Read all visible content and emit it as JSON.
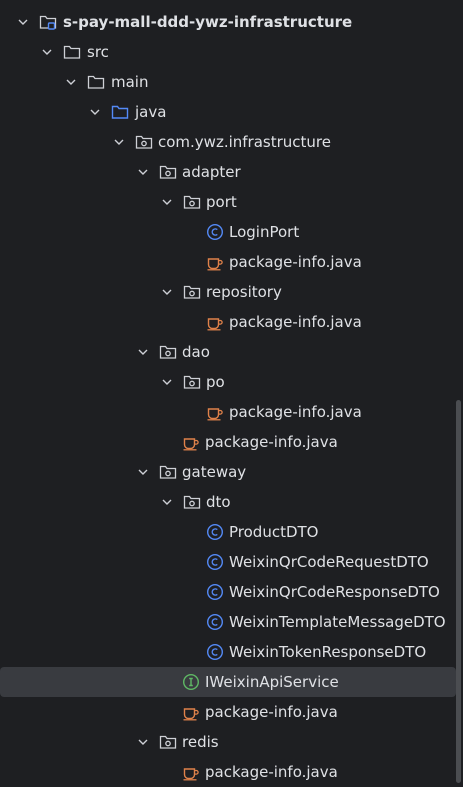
{
  "tree": {
    "root": {
      "label": "s-pay-mall-ddd-ywz-infrastructure",
      "icon": "module-folder-icon"
    },
    "src": {
      "label": "src",
      "icon": "folder-icon"
    },
    "main": {
      "label": "main",
      "icon": "folder-icon"
    },
    "java": {
      "label": "java",
      "icon": "source-root-folder-icon"
    },
    "pkg_infrastructure": {
      "label": "com.ywz.infrastructure",
      "icon": "package-icon"
    },
    "adapter": {
      "label": "adapter",
      "icon": "package-icon"
    },
    "port": {
      "label": "port",
      "icon": "package-icon"
    },
    "login_port": {
      "label": "LoginPort",
      "icon": "class-icon"
    },
    "port_pkg_info": {
      "label": "package-info.java",
      "icon": "java-file-icon"
    },
    "repository": {
      "label": "repository",
      "icon": "package-icon"
    },
    "repository_pkg_info": {
      "label": "package-info.java",
      "icon": "java-file-icon"
    },
    "dao": {
      "label": "dao",
      "icon": "package-icon"
    },
    "po": {
      "label": "po",
      "icon": "package-icon"
    },
    "po_pkg_info": {
      "label": "package-info.java",
      "icon": "java-file-icon"
    },
    "dao_pkg_info": {
      "label": "package-info.java",
      "icon": "java-file-icon"
    },
    "gateway": {
      "label": "gateway",
      "icon": "package-icon"
    },
    "dto": {
      "label": "dto",
      "icon": "package-icon"
    },
    "product_dto": {
      "label": "ProductDTO",
      "icon": "class-icon"
    },
    "qr_request_dto": {
      "label": "WeixinQrCodeRequestDTO",
      "icon": "class-icon"
    },
    "qr_response_dto": {
      "label": "WeixinQrCodeResponseDTO",
      "icon": "class-icon"
    },
    "template_message_dto": {
      "label": "WeixinTemplateMessageDTO",
      "icon": "class-icon"
    },
    "token_response_dto": {
      "label": "WeixinTokenResponseDTO",
      "icon": "class-icon"
    },
    "weixin_api_service": {
      "label": "IWeixinApiService",
      "icon": "interface-icon",
      "selected": true
    },
    "gateway_pkg_info": {
      "label": "package-info.java",
      "icon": "java-file-icon"
    },
    "redis": {
      "label": "redis",
      "icon": "package-icon"
    },
    "redis_pkg_info": {
      "label": "package-info.java",
      "icon": "java-file-icon"
    }
  },
  "colors": {
    "background": "#1e1f22",
    "text": "#dfe1e5",
    "selection": "#393b40",
    "class_icon": "#548af7",
    "interface_icon": "#5fb865",
    "java_file_icon": "#e0824a",
    "source_root_folder": "#548af7",
    "folder_outline": "#ced0d6"
  }
}
